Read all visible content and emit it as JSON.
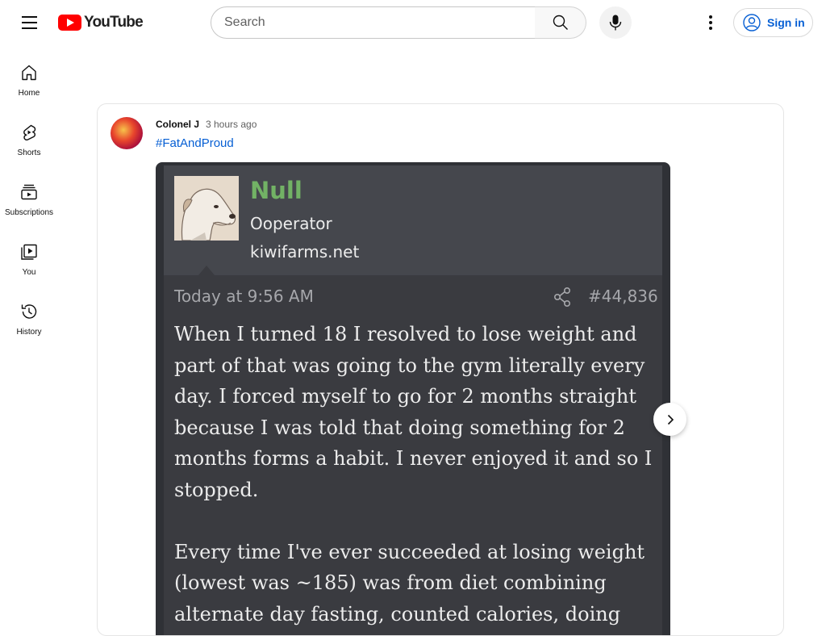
{
  "header": {
    "logo_text": "YouTube",
    "search_placeholder": "Search",
    "sign_in_label": "Sign in"
  },
  "sidebar": {
    "items": [
      {
        "label": "Home",
        "icon": "home-icon"
      },
      {
        "label": "Shorts",
        "icon": "shorts-icon"
      },
      {
        "label": "Subscriptions",
        "icon": "subscriptions-icon"
      },
      {
        "label": "You",
        "icon": "you-icon"
      },
      {
        "label": "History",
        "icon": "history-icon"
      }
    ]
  },
  "post": {
    "author": "Colonel J",
    "time": "3 hours ago",
    "hashtag": "#FatAndProud",
    "image": {
      "username": "Null",
      "role": "Ooperator",
      "site": "kiwifarms.net",
      "date": "Today at 9:56 AM",
      "post_number": "#44,836",
      "paragraph1": "When I turned 18 I resolved to lose weight and part of that was going to the gym literally every day. I forced myself to go for 2 months straight because I was told that doing something for 2 months forms a habit. I never enjoyed it and so I stopped.",
      "paragraph2": "Every time I've ever succeeded at losing weight (lowest was ~185) was from diet combining alternate day fasting, counted calories, doing"
    }
  },
  "colors": {
    "brand_red": "#ff0000",
    "link_blue": "#065fd4",
    "username_green": "#72b265"
  }
}
